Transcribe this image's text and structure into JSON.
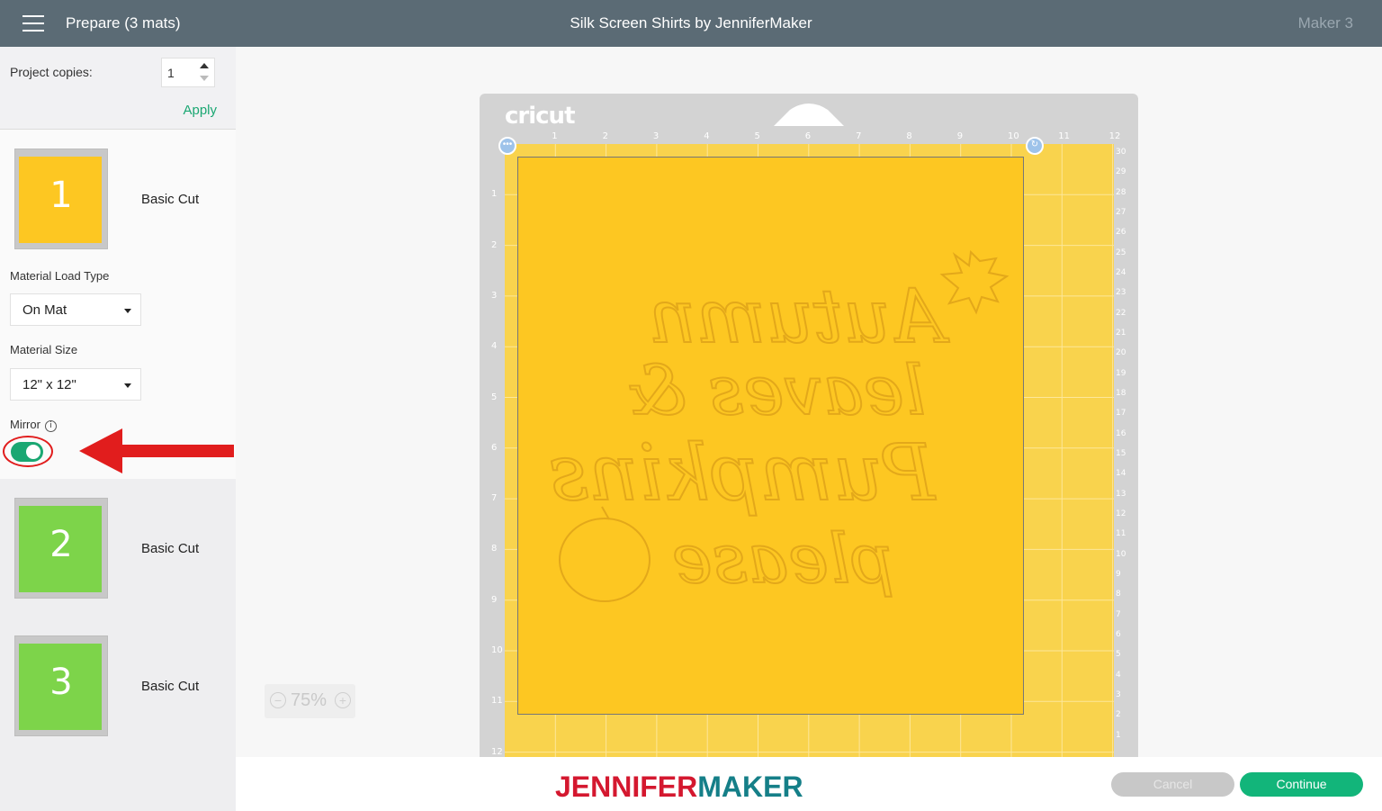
{
  "header": {
    "prepare_label": "Prepare (3 mats)",
    "project_title": "Silk Screen Shirts by JenniferMaker",
    "machine": "Maker 3"
  },
  "copies": {
    "label": "Project copies:",
    "value": "1",
    "apply_label": "Apply"
  },
  "mats": [
    {
      "number": "1",
      "label": "Basic Cut",
      "color": "#fdc722"
    },
    {
      "number": "2",
      "label": "Basic Cut",
      "color": "#7dd44a"
    },
    {
      "number": "3",
      "label": "Basic Cut",
      "color": "#7dd44a"
    }
  ],
  "material_load": {
    "label": "Material Load Type",
    "value": "On Mat"
  },
  "material_size": {
    "label": "Material Size",
    "value": "12\" x 12\""
  },
  "mirror": {
    "label": "Mirror",
    "on": true
  },
  "canvas": {
    "brand": "cricut",
    "zoom": "75%",
    "ruler_top": [
      "1",
      "2",
      "3",
      "4",
      "5",
      "6",
      "7",
      "8",
      "9",
      "10",
      "11",
      "12"
    ],
    "ruler_left": [
      "1",
      "2",
      "3",
      "4",
      "5",
      "6",
      "7",
      "8",
      "9",
      "10",
      "11",
      "12"
    ],
    "ruler_right": [
      "30",
      "29",
      "28",
      "27",
      "26",
      "25",
      "24",
      "23",
      "22",
      "21",
      "20",
      "19",
      "18",
      "17",
      "16",
      "15",
      "14",
      "13",
      "12",
      "11",
      "10",
      "9",
      "8",
      "7",
      "6",
      "5",
      "4",
      "3",
      "2",
      "1"
    ],
    "design_lines": [
      "Autumn",
      "leaves &",
      "Pumpkins",
      "please"
    ],
    "mat_color": "#f9d34d",
    "sheet_color": "#fdc722"
  },
  "footer": {
    "cancel_label": "Cancel",
    "continue_label": "Continue",
    "logo_part1": "JENNIFER",
    "logo_part2": "MAKER"
  },
  "accent_color": "#12b57a",
  "annotation_color": "#e11d1d"
}
